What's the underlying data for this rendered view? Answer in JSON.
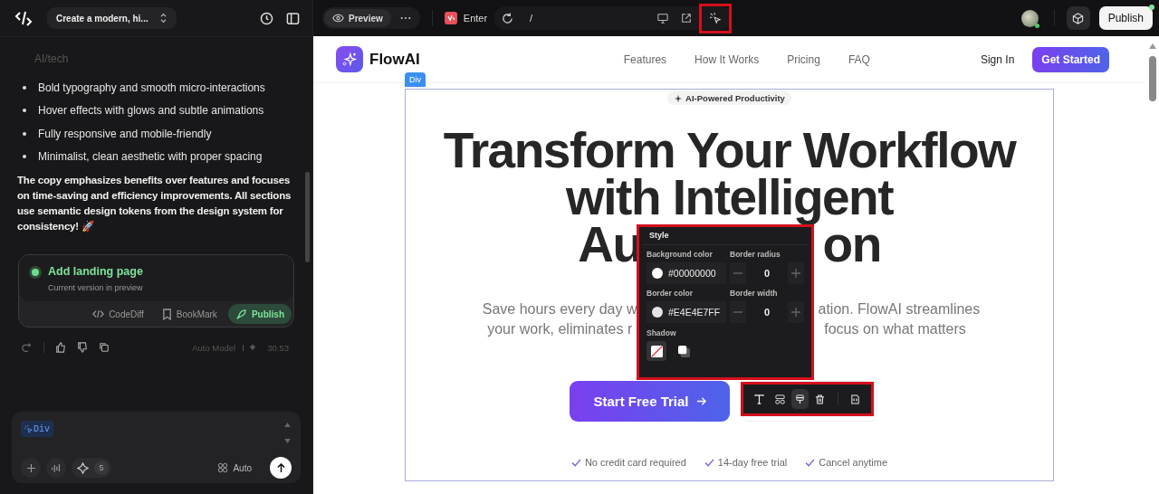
{
  "sidebar": {
    "project_title": "Create a modern, hi...",
    "chat": {
      "faded_line": "AI/tech",
      "bullets": [
        "Bold typography and smooth micro-interactions",
        "Hover effects with glows and subtle animations",
        "Fully responsive and mobile-friendly",
        "Minimalist, clean aesthetic with proper spacing"
      ],
      "paragraph": "The copy emphasizes benefits over features and focuses on time-saving and efficiency improvements. All sections use semantic design tokens from the design system for consistency! 🚀"
    },
    "version_card": {
      "title": "Add landing page",
      "subtitle": "Current version in preview",
      "actions": [
        {
          "label": "CodeDiff",
          "kind": "code",
          "selected": false
        },
        {
          "label": "BookMark",
          "kind": "bookmark",
          "selected": false
        },
        {
          "label": "Publish",
          "kind": "publish",
          "selected": true
        }
      ]
    },
    "message_meta": {
      "model": "Auto Model",
      "credits": "30.53"
    },
    "composer": {
      "chip": "Div",
      "credit_count": "5",
      "model": "Auto"
    }
  },
  "toolbar": {
    "mode": "Preview",
    "page_name": "Enter",
    "path": "/",
    "inspect_active": true,
    "publish": "Publish"
  },
  "site": {
    "brand": "FlowAI",
    "nav": [
      "Features",
      "How It Works",
      "Pricing",
      "FAQ"
    ],
    "sign_in": "Sign In",
    "cta": "Get Started",
    "selection_tag": "Div",
    "badge": "AI-Powered Productivity",
    "headline": [
      "Transform Your Workflow",
      "with Intelligent"
    ],
    "headline_split": [
      "Au",
      "on"
    ],
    "subtitle": [
      [
        "Save hours every day w",
        "ation. FlowAI streamlines"
      ],
      [
        "your work, eliminates r",
        "focus on what matters"
      ]
    ],
    "primary_button": "Start Free Trial",
    "perks": [
      "No credit card required",
      "14-day free trial",
      "Cancel anytime"
    ]
  },
  "style_panel": {
    "title": "Style",
    "fields": [
      {
        "label": "Background color",
        "kind": "color",
        "value": "#00000000"
      },
      {
        "label": "Border radius",
        "kind": "stepper",
        "value": "0"
      },
      {
        "label": "Border color",
        "kind": "color",
        "value": "#E4E4E7FF"
      },
      {
        "label": "Border width",
        "kind": "stepper",
        "value": "0"
      }
    ],
    "shadow_label": "Shadow",
    "shadow_options": [
      {
        "kind": "none",
        "selected": true
      },
      {
        "kind": "drop",
        "selected": false
      }
    ]
  },
  "element_toolbar": {
    "tools": [
      {
        "kind": "text",
        "selected": false
      },
      {
        "kind": "layout",
        "selected": false
      },
      {
        "kind": "style",
        "selected": true
      },
      {
        "kind": "delete",
        "selected": false
      },
      {
        "kind": "code",
        "selected": false
      }
    ]
  }
}
